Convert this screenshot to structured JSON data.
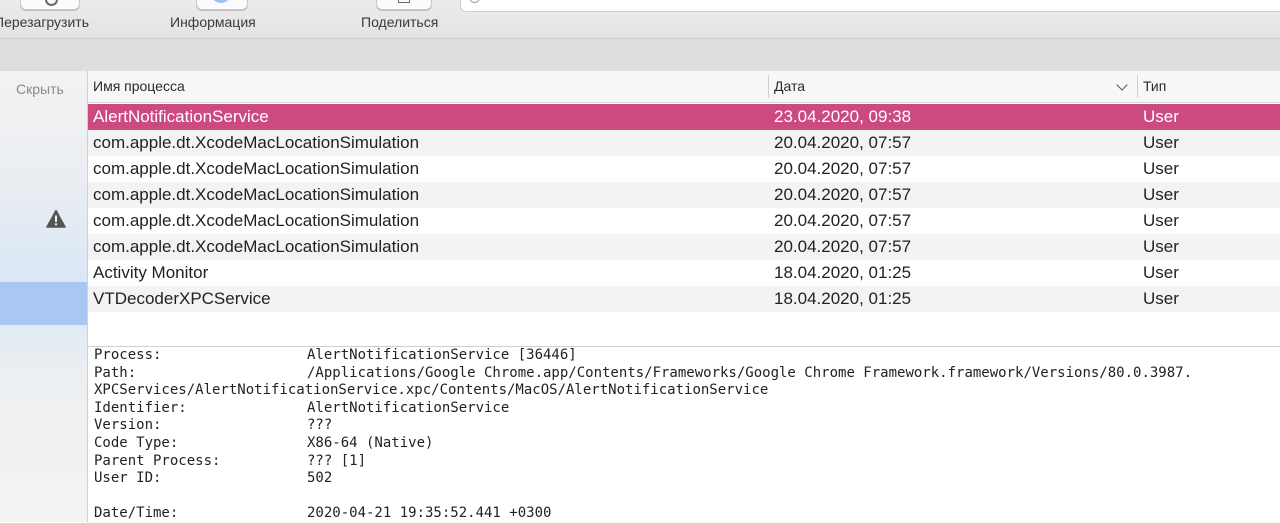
{
  "toolbar": {
    "restart_label": "Перезагрузить",
    "info_label": "Информация",
    "share_label": "Поделиться"
  },
  "sidebar": {
    "hide_label": "Скрыть",
    "warn_icon": "warning-triangle-icon"
  },
  "table": {
    "columns": {
      "name": "Имя процесса",
      "date": "Дата",
      "type": "Тип"
    },
    "sort_icon": "chevron-down-icon",
    "rows": [
      {
        "name": "AlertNotificationService",
        "date": "23.04.2020, 09:38",
        "type": "User",
        "selected": true
      },
      {
        "name": "com.apple.dt.XcodeMacLocationSimulation",
        "date": "20.04.2020, 07:57",
        "type": "User"
      },
      {
        "name": "com.apple.dt.XcodeMacLocationSimulation",
        "date": "20.04.2020, 07:57",
        "type": "User"
      },
      {
        "name": "com.apple.dt.XcodeMacLocationSimulation",
        "date": "20.04.2020, 07:57",
        "type": "User"
      },
      {
        "name": "com.apple.dt.XcodeMacLocationSimulation",
        "date": "20.04.2020, 07:57",
        "type": "User"
      },
      {
        "name": "com.apple.dt.XcodeMacLocationSimulation",
        "date": "20.04.2020, 07:57",
        "type": "User"
      },
      {
        "name": "Activity Monitor",
        "date": "18.04.2020, 01:25",
        "type": "User"
      },
      {
        "name": "VTDecoderXPCService",
        "date": "18.04.2020, 01:25",
        "type": "User"
      }
    ]
  },
  "detail": {
    "process_key": "Process:",
    "process_val": "AlertNotificationService [36446]",
    "path_key": "Path:",
    "path_val": "/Applications/Google Chrome.app/Contents/Frameworks/Google Chrome Framework.framework/Versions/80.0.3987.",
    "path_cont": "XPCServices/AlertNotificationService.xpc/Contents/MacOS/AlertNotificationService",
    "identifier_key": "Identifier:",
    "identifier_val": "AlertNotificationService",
    "version_key": "Version:",
    "version_val": "???",
    "codetype_key": "Code Type:",
    "codetype_val": "X86-64 (Native)",
    "parent_key": "Parent Process:",
    "parent_val": "??? [1]",
    "userid_key": "User ID:",
    "userid_val": "502",
    "datetime_key": "Date/Time:",
    "datetime_val": "2020-04-21 19:35:52.441 +0300"
  }
}
